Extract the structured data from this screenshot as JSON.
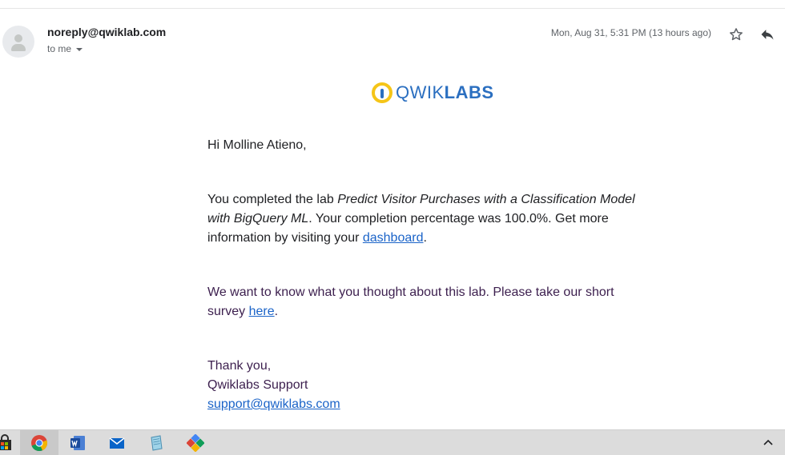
{
  "header": {
    "sender": "noreply@qwiklab.com",
    "recipient_label": "to me",
    "date": "Mon, Aug 31, 5:31 PM (13 hours ago)"
  },
  "logo": {
    "text_light": "QWIK",
    "text_bold": "LABS",
    "brand_color": "#2b6fc0",
    "icon_color": "#f5c518"
  },
  "body": {
    "greeting": "Hi Molline Atieno,",
    "p1_prefix": "You completed the lab ",
    "lab_name": "Predict Visitor Purchases with a Classification Model with BigQuery ML",
    "p1_middle": ". Your completion percentage was 100.0%. Get more information by visiting your ",
    "dashboard_link": "dashboard",
    "p1_end": ".",
    "p2_prefix": "We want to know what you thought about this lab. Please take our short survey ",
    "survey_link": "here",
    "p2_end": ".",
    "signoff": "Thank you,",
    "team": "Qwiklabs Support",
    "support_email": "support@qwiklabs.com"
  },
  "taskbar": {
    "items": [
      "store-icon",
      "chrome-icon",
      "word-icon",
      "mail-icon",
      "notepad-icon",
      "paint-icon"
    ],
    "active": "chrome-icon"
  },
  "colors": {
    "link": "#1a63c8",
    "purple_text": "#3c1f4e",
    "taskbar": "#dcdcdc"
  }
}
